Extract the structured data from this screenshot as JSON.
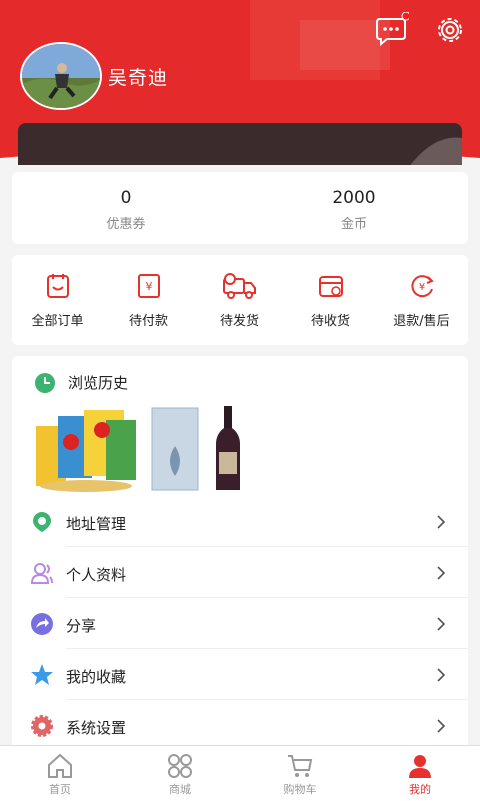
{
  "header": {
    "username": "吴奇迪"
  },
  "stats": [
    {
      "value": "0",
      "label": "优惠券"
    },
    {
      "value": "2000",
      "label": "金币"
    }
  ],
  "orders": [
    {
      "label": "全部订单",
      "icon": "order-list-icon"
    },
    {
      "label": "待付款",
      "icon": "payment-icon"
    },
    {
      "label": "待发货",
      "icon": "truck-icon"
    },
    {
      "label": "待收货",
      "icon": "box-icon"
    },
    {
      "label": "退款/售后",
      "icon": "refund-icon"
    }
  ],
  "history": {
    "title": "浏览历史"
  },
  "menu": [
    {
      "label": "地址管理",
      "icon": "location-icon"
    },
    {
      "label": "个人资料",
      "icon": "profile-icon"
    },
    {
      "label": "分享",
      "icon": "share-icon"
    },
    {
      "label": "我的收藏",
      "icon": "star-icon"
    },
    {
      "label": "系统设置",
      "icon": "settings-icon"
    }
  ],
  "tabs": [
    {
      "label": "首页",
      "icon": "home-icon"
    },
    {
      "label": "商城",
      "icon": "mall-icon"
    },
    {
      "label": "购物车",
      "icon": "cart-icon"
    },
    {
      "label": "我的",
      "icon": "user-icon"
    }
  ],
  "colors": {
    "accent": "#e5322d",
    "header_red": "#e42a2a"
  }
}
